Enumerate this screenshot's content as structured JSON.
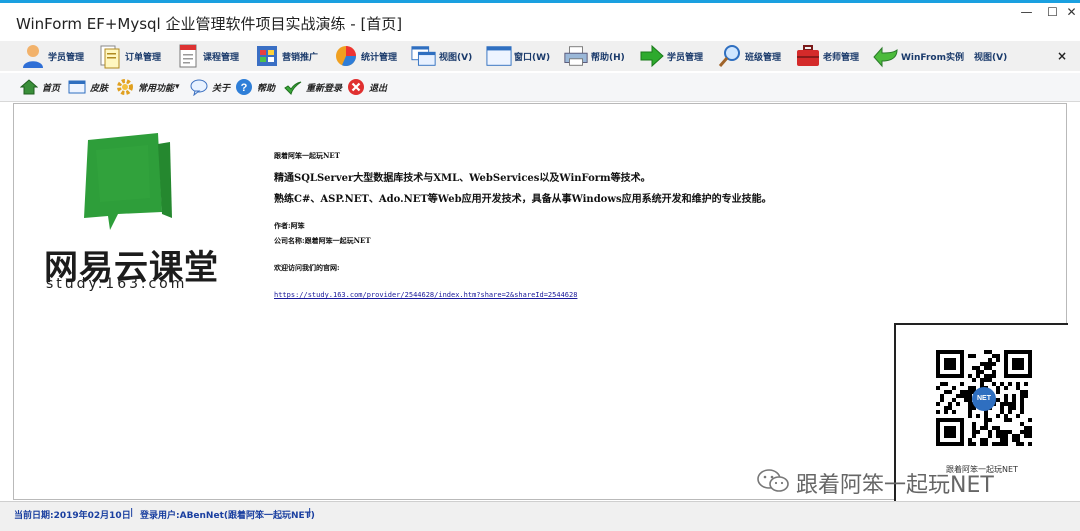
{
  "window": {
    "title": "WinForm EF+Mysql 企业管理软件项目实战演练 - [首页]",
    "minimize_glyph": "—",
    "maximize_glyph": "☐",
    "close_glyph": "✕"
  },
  "menu": {
    "items": [
      {
        "label": "学员管理",
        "icon": "user-icon"
      },
      {
        "label": "订单管理",
        "icon": "documents-icon"
      },
      {
        "label": "课程管理",
        "icon": "document-icon"
      },
      {
        "label": "营销推广",
        "icon": "grid-icon"
      },
      {
        "label": "统计管理",
        "icon": "pie-chart-icon"
      },
      {
        "label": "视图(V)",
        "icon": "windows-icon"
      },
      {
        "label": "窗口(W)",
        "icon": "window-icon"
      },
      {
        "label": "帮助(H)",
        "icon": "printer-icon"
      },
      {
        "label": "学员管理",
        "icon": "arrow-right-icon"
      },
      {
        "label": "班级管理",
        "icon": "magnifier-icon"
      },
      {
        "label": "老师管理",
        "icon": "toolbox-icon"
      },
      {
        "label": "WinFrom实例",
        "icon": "arrow-back-icon"
      },
      {
        "label": "视图(V)",
        "icon": ""
      }
    ],
    "close_glyph": "×"
  },
  "toolbar": {
    "items": [
      {
        "label": "首页",
        "icon": "home-icon"
      },
      {
        "label": "皮肤",
        "icon": "window-icon"
      },
      {
        "label": "常用功能",
        "icon": "gear-icon",
        "dropdown": "▾"
      },
      {
        "label": "关于",
        "icon": "speech-icon"
      },
      {
        "label": "帮助",
        "icon": "help-icon"
      },
      {
        "label": "重新登录",
        "icon": "checkmark-icon"
      },
      {
        "label": "退出",
        "icon": "close-icon"
      }
    ]
  },
  "content": {
    "logo": {
      "brand": "网易云课堂",
      "sub": "study.163.com"
    },
    "heading": "跟着阿笨一起玩NET",
    "line1": "精通SQLServer大型数据库技术与XML、WebServices以及WinForm等技术。",
    "line2": "熟练C#、ASP.NET、Ado.NET等Web应用开发技术，具备从事Windows应用系统开发和维护的专业技能。",
    "author": "作者:阿笨",
    "company": "公司名称:跟着阿笨一起玩NET",
    "welcome": "欢迎访问我们的官网:",
    "url": "https://study.163.com/provider/2544628/index.htm?share=2&shareId=2544628",
    "qr_center": "NET",
    "qr_caption": "跟着阿笨一起玩NET",
    "watermark": "跟着阿笨一起玩NET"
  },
  "status": {
    "date": "当前日期:2019年02月10日",
    "sep": "|",
    "user": "登录用户:ABenNet(跟着阿笨一起玩NET)"
  },
  "colors": {
    "accent": "#1aa0e0",
    "status_text": "#1a3fa0",
    "logo_green": "#2e9e3a"
  }
}
